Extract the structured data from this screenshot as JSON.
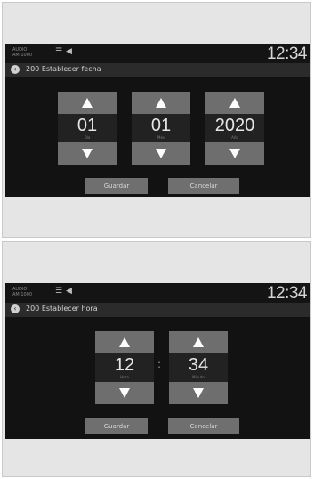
{
  "screens": [
    {
      "status": {
        "mini_line1": "AUDIO",
        "mini_line2": "AM 1000",
        "menu_icon": "menu-icon",
        "speaker_icon": "speaker-icon",
        "clock": "12:34"
      },
      "title": "200 Establecer fecha",
      "spinners": [
        {
          "value": "01",
          "label": "Día"
        },
        {
          "value": "01",
          "label": "Mes"
        },
        {
          "value": "2020",
          "label": "Año"
        }
      ],
      "buttons": {
        "save": "Guardar",
        "cancel": "Cancelar"
      }
    },
    {
      "status": {
        "mini_line1": "AUDIO",
        "mini_line2": "AM 1000",
        "menu_icon": "menu-icon",
        "speaker_icon": "speaker-icon",
        "clock": "12:34"
      },
      "title": "200 Establecer hora",
      "spinners": [
        {
          "value": "12",
          "label": "Hora"
        },
        {
          "value": "34",
          "label": "Minuto"
        }
      ],
      "separator": ":",
      "buttons": {
        "save": "Guardar",
        "cancel": "Cancelar"
      }
    }
  ]
}
